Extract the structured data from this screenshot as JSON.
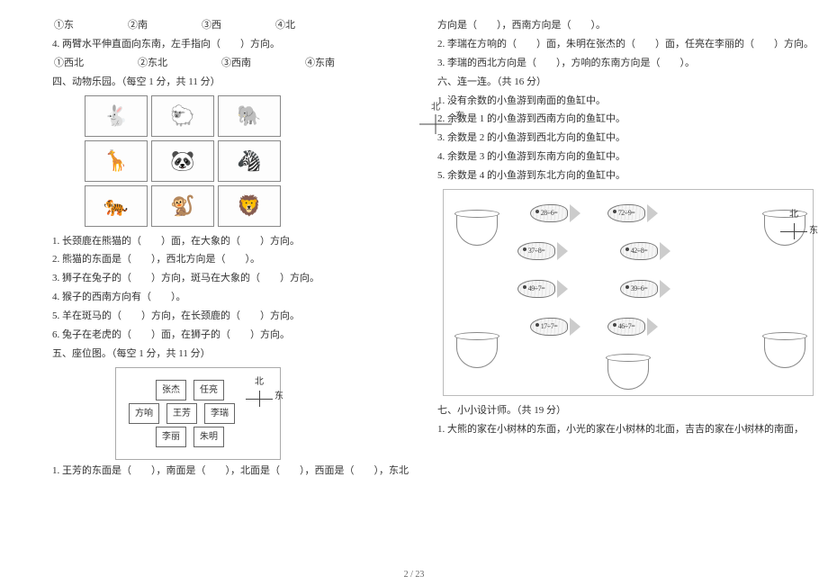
{
  "left": {
    "opts_q3": {
      "a": "①东",
      "b": "②南",
      "c": "③西",
      "d": "④北"
    },
    "q4": "4. 两臂水平伸直面向东南，左手指向（　　）方向。",
    "opts_q4": {
      "a": "①西北",
      "b": "②东北",
      "c": "③西南",
      "d": "④东南"
    },
    "sec4_title": "四、动物乐园。（每空 1 分，共 11 分）",
    "compass": {
      "n": "北",
      "e": "东"
    },
    "zoo": {
      "q1": "1. 长颈鹿在熊猫的（　　）面，在大象的（　　）方向。",
      "q2": "2. 熊猫的东面是（　　），西北方向是（　　）。",
      "q3": "3. 狮子在兔子的（　　）方向，斑马在大象的（　　）方向。",
      "q4": "4. 猴子的西南方向有（　　）。",
      "q5": "5. 羊在斑马的（　　）方向，在长颈鹿的（　　）方向。",
      "q6": "6. 兔子在老虎的（　　）面，在狮子的（　　）方向。"
    },
    "sec5_title": "五、座位图。（每空 1 分，共 11 分）",
    "seats": {
      "r1a": "张杰",
      "r1b": "任亮",
      "r2a": "方响",
      "r2b": "王芳",
      "r2c": "李瑞",
      "r3a": "李丽",
      "r3b": "朱明"
    },
    "seat_q1": "1. 王芳的东面是（　　），南面是（　　），北面是（　　），西面是（　　），东北"
  },
  "right": {
    "cont1": "方向是（　　），西南方向是（　　）。",
    "q2": "2. 李瑞在方响的（　　）面，朱明在张杰的（　　）面，任亮在李丽的（　　）方向。",
    "q3": "3. 李瑞的西北方向是（　　），方响的东南方向是（　　）。",
    "sec6_title": "六、连一连。（共 16 分）",
    "r1": "1. 没有余数的小鱼游到南面的鱼缸中。",
    "r2": "2. 余数是 1 的小鱼游到西南方向的鱼缸中。",
    "r3": "3. 余数是 2 的小鱼游到西北方向的鱼缸中。",
    "r4": "4. 余数是 3 的小鱼游到东南方向的鱼缸中。",
    "r5": "5. 余数是 4 的小鱼游到东北方向的鱼缸中。",
    "fish_labels": {
      "f1": "28÷6=",
      "f2": "72÷9=",
      "f3": "37÷8=",
      "f4": "42÷8=",
      "f5": "49÷7=",
      "f6": "39÷6=",
      "f7": "17÷7=",
      "f8": "46÷7="
    },
    "sec7_title": "七、小小设计师。（共 19 分）",
    "sec7_q1": "1. 大熊的家在小树林的东面，小光的家在小树林的北面，吉吉的家在小树林的南面，"
  },
  "pager": "2 / 23"
}
